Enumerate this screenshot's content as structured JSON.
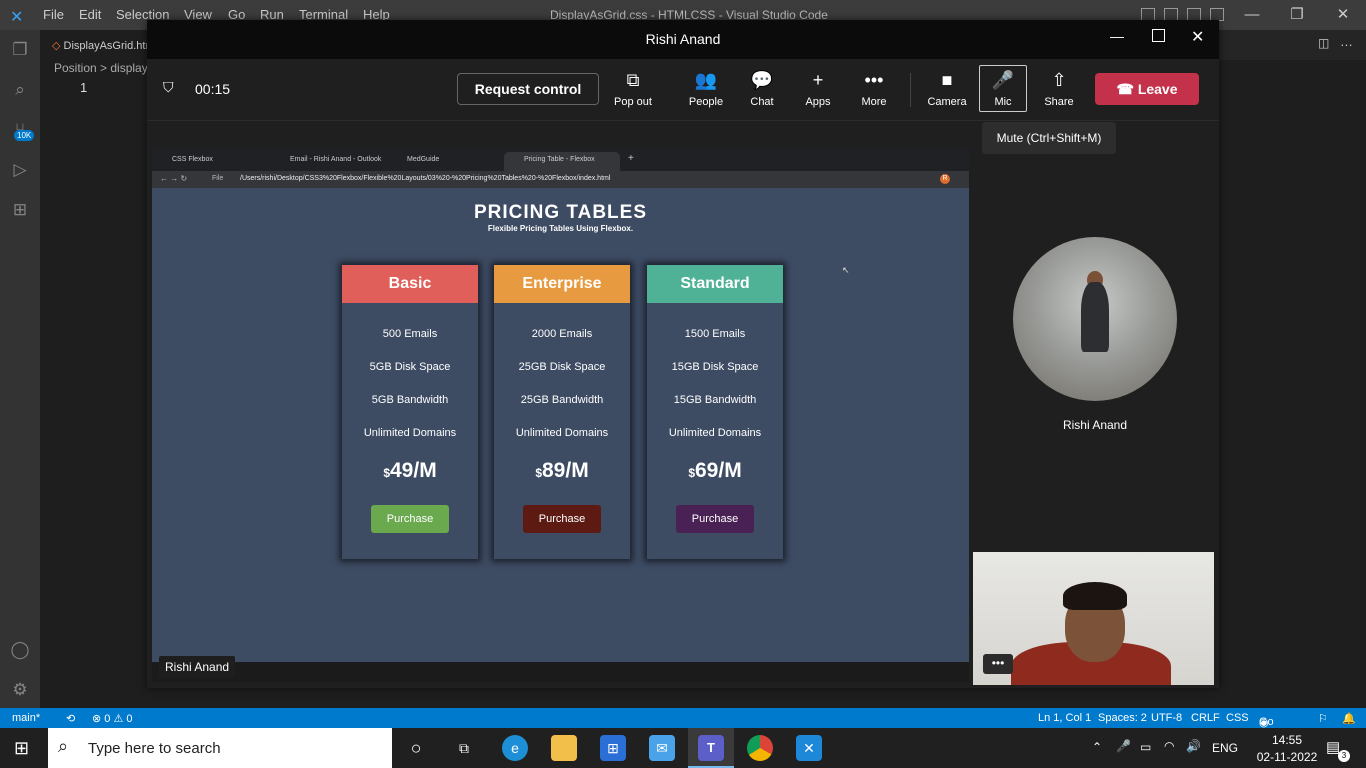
{
  "vscode": {
    "menu": [
      "File",
      "Edit",
      "Selection",
      "View",
      "Go",
      "Run",
      "Terminal",
      "Help"
    ],
    "window_title": "DisplayAsGrid.css - HTMLCSS - Visual Studio Code",
    "tab": "DisplayAsGrid.htı",
    "breadcrumb": "Position > displayFl",
    "line_number": "1",
    "badge": "10K",
    "status": {
      "branch": "main*",
      "errors": "⊗ 0 ⚠ 0",
      "cursor": "Ln 1, Col 1",
      "spaces": "Spaces: 2",
      "encoding": "UTF-8",
      "eol": "CRLF",
      "language": "CSS",
      "golive": "Go Live"
    }
  },
  "teams": {
    "title": "Rishi Anand",
    "timer": "00:15",
    "request_control": "Request control",
    "controls": [
      {
        "label": "Pop out",
        "icon": "⧉"
      },
      {
        "label": "People",
        "icon": "👥"
      },
      {
        "label": "Chat",
        "icon": "💬"
      },
      {
        "label": "Apps",
        "icon": "+"
      },
      {
        "label": "More",
        "icon": "•••"
      },
      {
        "label": "Camera",
        "icon": "■"
      },
      {
        "label": "Mic",
        "icon": "🎤"
      },
      {
        "label": "Share",
        "icon": "⇧"
      }
    ],
    "leave": "Leave",
    "tooltip": "Mute (Ctrl+Shift+M)",
    "presenter_tag": "Rishi Anand",
    "participant_name": "Rishi Anand",
    "self_more": "•••"
  },
  "browser": {
    "tabs": [
      "CSS Flexbox",
      "Email - Rishi Anand - Outlook",
      "MedGuide",
      "Pricing Table - Flexbox"
    ],
    "url_prefix": "File",
    "url": "/Users/rishi/Desktop/CSS3%20Flexbox/Flexible%20Layouts/03%20-%20Pricing%20Tables%20-%20Flexbox/index.html",
    "profile": "R"
  },
  "pricing": {
    "title": "PRICING TABLES",
    "subtitle": "Flexible Pricing Tables Using Flexbox.",
    "cards": [
      {
        "name": "Basic",
        "color": "#e05f5a",
        "features": [
          "500 Emails",
          "5GB Disk Space",
          "5GB Bandwidth",
          "Unlimited Domains"
        ],
        "currency": "$",
        "price": "49/M",
        "button": "Purchase",
        "button_color": "#6ba94f"
      },
      {
        "name": "Enterprise",
        "color": "#e79a3f",
        "features": [
          "2000 Emails",
          "25GB Disk Space",
          "25GB Bandwidth",
          "Unlimited Domains"
        ],
        "currency": "$",
        "price": "89/M",
        "button": "Purchase",
        "button_color": "#5c1a12"
      },
      {
        "name": "Standard",
        "color": "#4fb196",
        "features": [
          "1500 Emails",
          "15GB Disk Space",
          "15GB Bandwidth",
          "Unlimited Domains"
        ],
        "currency": "$",
        "price": "69/M",
        "button": "Purchase",
        "button_color": "#4a2155"
      }
    ]
  },
  "taskbar": {
    "search_placeholder": "Type here to search",
    "lang": "ENG",
    "time": "14:55",
    "date": "02-11-2022",
    "notifications": "3"
  }
}
